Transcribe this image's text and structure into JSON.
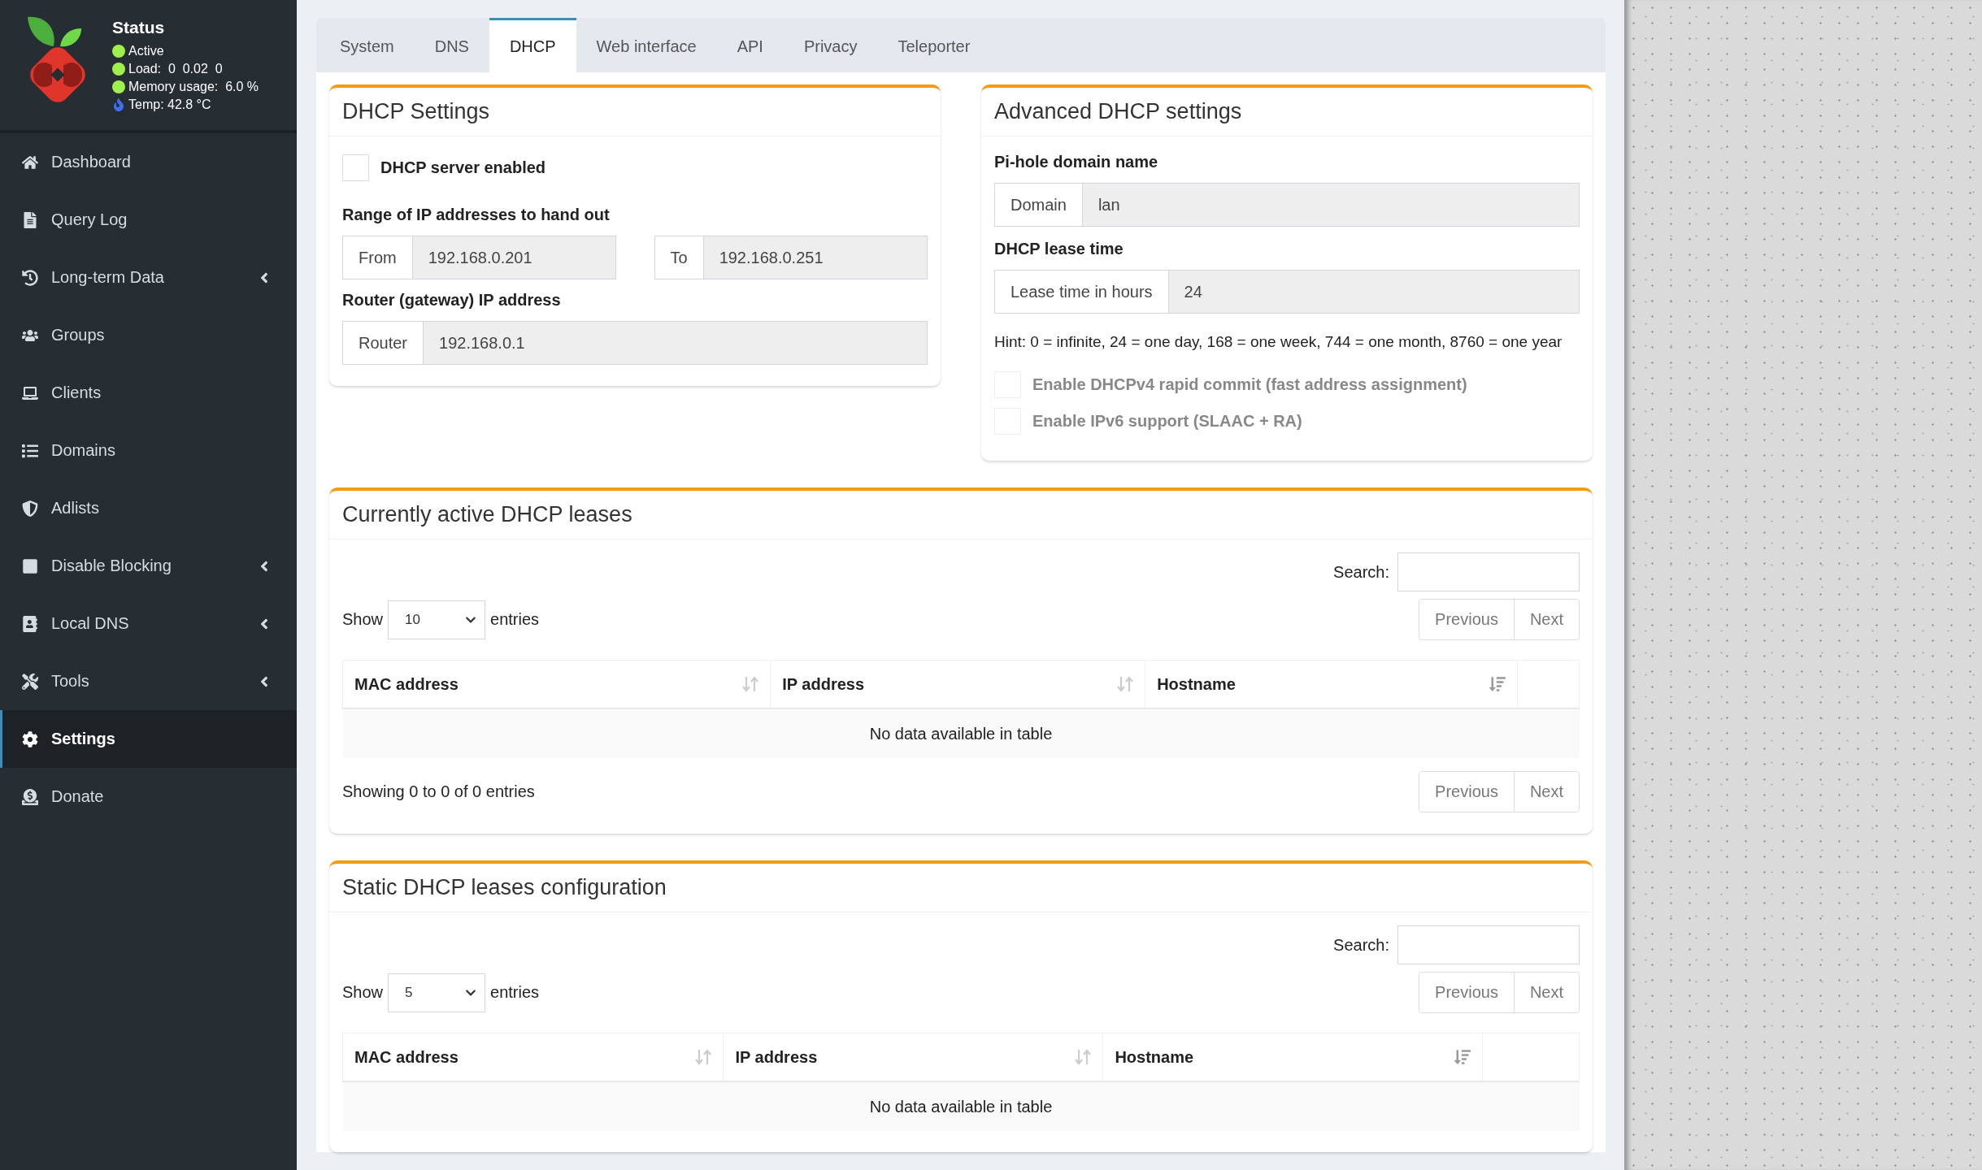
{
  "sidebar": {
    "status": {
      "title": "Status",
      "items": [
        {
          "kind": "dot",
          "text": "Active"
        },
        {
          "kind": "dot",
          "text": "Load:  0  0.02  0"
        },
        {
          "kind": "dot",
          "text": "Memory usage:  6.0 %"
        },
        {
          "kind": "temp",
          "text": "Temp: 42.8 °C"
        }
      ]
    },
    "menu": [
      {
        "label": "Dashboard",
        "expandable": false,
        "selected": false
      },
      {
        "label": "Query Log",
        "expandable": false,
        "selected": false
      },
      {
        "label": "Long-term Data",
        "expandable": true,
        "selected": false
      },
      {
        "label": "Groups",
        "expandable": false,
        "selected": false
      },
      {
        "label": "Clients",
        "expandable": false,
        "selected": false
      },
      {
        "label": "Domains",
        "expandable": false,
        "selected": false
      },
      {
        "label": "Adlists",
        "expandable": false,
        "selected": false
      },
      {
        "label": "Disable Blocking",
        "expandable": true,
        "selected": false
      },
      {
        "label": "Local DNS",
        "expandable": true,
        "selected": false
      },
      {
        "label": "Tools",
        "expandable": true,
        "selected": false
      },
      {
        "label": "Settings",
        "expandable": false,
        "selected": true
      },
      {
        "label": "Donate",
        "expandable": false,
        "selected": false
      }
    ]
  },
  "tabs": [
    {
      "label": "System",
      "selected": false
    },
    {
      "label": "DNS",
      "selected": false
    },
    {
      "label": "DHCP",
      "selected": true
    },
    {
      "label": "Web interface",
      "selected": false
    },
    {
      "label": "API",
      "selected": false
    },
    {
      "label": "Privacy",
      "selected": false
    },
    {
      "label": "Teleporter",
      "selected": false
    }
  ],
  "dhcp_settings": {
    "title": "DHCP Settings",
    "server_enabled": {
      "label": "DHCP server enabled",
      "checked": false
    },
    "range_label": "Range of IP addresses to hand out",
    "from": {
      "addon": "From",
      "value": "192.168.0.201"
    },
    "to": {
      "addon": "To",
      "value": "192.168.0.251"
    },
    "router_label": "Router (gateway) IP address",
    "router": {
      "addon": "Router",
      "value": "192.168.0.1"
    }
  },
  "advanced": {
    "title": "Advanced DHCP settings",
    "domain_label": "Pi-hole domain name",
    "domain": {
      "addon": "Domain",
      "value": "lan"
    },
    "lease_label": "DHCP lease time",
    "lease": {
      "addon": "Lease time in hours",
      "value": "24"
    },
    "hint": "Hint: 0 = infinite, 24 = one day, 168 = one week, 744 = one month, 8760 = one year",
    "options": [
      {
        "label": "Enable DHCPv4 rapid commit (fast address assignment)",
        "checked": false,
        "disabled": true
      },
      {
        "label": "Enable IPv6 support (SLAAC + RA)",
        "checked": false,
        "disabled": true
      }
    ]
  },
  "tables": [
    {
      "title": "Currently active DHCP leases",
      "search_label": "Search:",
      "show_label": "Show",
      "length": "10",
      "entries_label": "entries",
      "pagination": [
        {
          "label": "Previous",
          "disabled": true
        },
        {
          "label": "Next",
          "disabled": true
        }
      ],
      "columns": [
        {
          "label": "MAC address",
          "sorted": false
        },
        {
          "label": "IP address",
          "sorted": false
        },
        {
          "label": "Hostname",
          "sorted": true
        }
      ],
      "empty": "No data available in table",
      "info": "Showing 0 to 0 of 0 entries",
      "bottom_pagination": [
        {
          "label": "Previous",
          "disabled": true
        },
        {
          "label": "Next",
          "disabled": true
        }
      ]
    },
    {
      "title": "Static DHCP leases configuration",
      "search_label": "Search:",
      "show_label": "Show",
      "length": "5",
      "entries_label": "entries",
      "pagination": [
        {
          "label": "Previous",
          "disabled": true
        },
        {
          "label": "Next",
          "disabled": true
        }
      ],
      "columns": [
        {
          "label": "MAC address",
          "sorted": false
        },
        {
          "label": "IP address",
          "sorted": false
        },
        {
          "label": "Hostname",
          "sorted": true
        }
      ],
      "empty": "No data available in table"
    }
  ]
}
